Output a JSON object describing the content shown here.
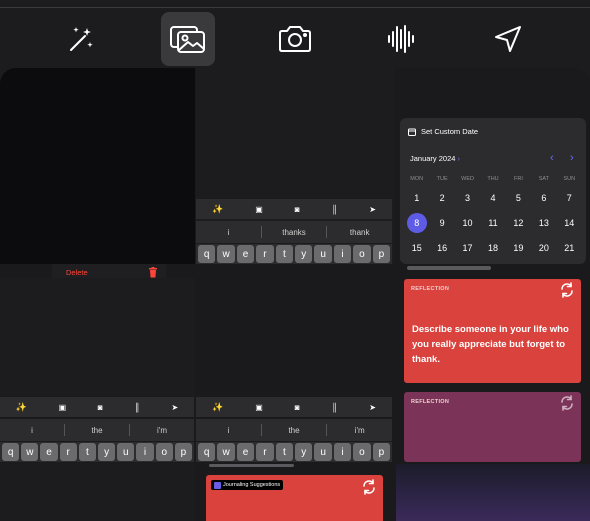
{
  "toolbar": {
    "items": [
      {
        "name": "magic-wand-icon",
        "active": false
      },
      {
        "name": "photos-icon",
        "active": true
      },
      {
        "name": "camera-icon",
        "active": false
      },
      {
        "name": "audio-waveform-icon",
        "active": false
      },
      {
        "name": "location-arrow-icon",
        "active": false
      }
    ]
  },
  "keyboard_a": {
    "suggestions": [
      "i",
      "thanks",
      "thank"
    ],
    "keys": [
      "q",
      "w",
      "e",
      "r",
      "t",
      "y",
      "u",
      "i",
      "o",
      "p"
    ]
  },
  "keyboard_b": {
    "suggestions": [
      "i",
      "the",
      "i'm"
    ],
    "keys": [
      "q",
      "w",
      "e",
      "r",
      "t",
      "y",
      "u",
      "i",
      "o",
      "p"
    ]
  },
  "keyboard_c": {
    "suggestions": [
      "i",
      "the",
      "i'm"
    ],
    "keys": [
      "q",
      "w",
      "e",
      "r",
      "t",
      "y",
      "u",
      "i",
      "o",
      "p"
    ]
  },
  "context_menu": {
    "delete_label": "Delete"
  },
  "calendar": {
    "title": "Set Custom Date",
    "month": "January 2024",
    "weekdays": [
      "MON",
      "TUE",
      "WED",
      "THU",
      "FRI",
      "SAT",
      "SUN"
    ],
    "days": [
      "1",
      "2",
      "3",
      "4",
      "5",
      "6",
      "7",
      "8",
      "9",
      "10",
      "11",
      "12",
      "13",
      "14",
      "15",
      "16",
      "17",
      "18",
      "19",
      "20",
      "21"
    ],
    "selected_day": "8",
    "accent": "#5e5ce6"
  },
  "cards": [
    {
      "tag": "REFLECTION",
      "text": "Describe someone in your life who you really appreciate but forget to thank.",
      "color": "#d9423d"
    },
    {
      "tag": "REFLECTION",
      "text": "",
      "color": "#7b3357"
    }
  ],
  "suggestion_chip": {
    "label": "Journaling Suggestions",
    "card_color": "#d9423d"
  }
}
